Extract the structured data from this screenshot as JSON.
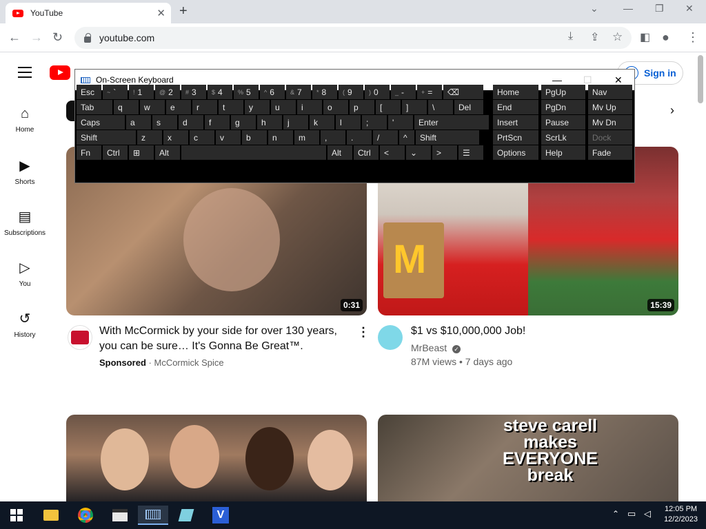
{
  "browser": {
    "tab_title": "YouTube",
    "url": "youtube.com"
  },
  "youtube": {
    "sign_in_label": "Sign in",
    "sidebar": [
      {
        "label": "Home",
        "icon": "home-icon"
      },
      {
        "label": "Shorts",
        "icon": "shorts-icon"
      },
      {
        "label": "Subscriptions",
        "icon": "subscriptions-icon"
      },
      {
        "label": "You",
        "icon": "you-icon"
      },
      {
        "label": "History",
        "icon": "history-icon"
      }
    ],
    "videos": [
      {
        "title_line1": "With McCormick by your side for over 130 years,",
        "title_line2": "you can be sure… It's Gonna Be Great™.",
        "sponsored": "Sponsored",
        "channel": "McCormick Spice",
        "duration": "0:31"
      },
      {
        "title": "$1 vs $10,000,000 Job!",
        "channel": "MrBeast",
        "stats": "87M views • 7 days ago",
        "duration": "15:39"
      }
    ],
    "thumb3_text": [
      "steve carell",
      "makes",
      "EVERYONE",
      "break"
    ]
  },
  "osk": {
    "title": "On-Screen Keyboard",
    "row1": [
      {
        "main": "Esc",
        "sub": ""
      },
      {
        "main": "`",
        "sub": "~"
      },
      {
        "main": "1",
        "sub": "!"
      },
      {
        "main": "2",
        "sub": "@"
      },
      {
        "main": "3",
        "sub": "#"
      },
      {
        "main": "4",
        "sub": "$"
      },
      {
        "main": "5",
        "sub": "%"
      },
      {
        "main": "6",
        "sub": "^"
      },
      {
        "main": "7",
        "sub": "&"
      },
      {
        "main": "8",
        "sub": "*"
      },
      {
        "main": "9",
        "sub": "("
      },
      {
        "main": "0",
        "sub": ")"
      },
      {
        "main": "-",
        "sub": "_"
      },
      {
        "main": "=",
        "sub": "+"
      },
      {
        "main": "⌫",
        "sub": ""
      }
    ],
    "row2": [
      "Tab",
      "q",
      "w",
      "e",
      "r",
      "t",
      "y",
      "u",
      "i",
      "o",
      "p",
      "[",
      "]",
      "\\",
      "Del"
    ],
    "row3": [
      "Caps",
      "a",
      "s",
      "d",
      "f",
      "g",
      "h",
      "j",
      "k",
      "l",
      ";",
      "'",
      "Enter"
    ],
    "row4": [
      "Shift",
      "z",
      "x",
      "c",
      "v",
      "b",
      "n",
      "m",
      ",",
      ".",
      "/",
      "^",
      "Shift"
    ],
    "row5": [
      "Fn",
      "Ctrl",
      "⊞",
      "Alt",
      "",
      "Alt",
      "Ctrl",
      "<",
      "⌄",
      ">",
      "☰"
    ],
    "nav": [
      [
        "Home",
        "PgUp",
        "Nav"
      ],
      [
        "End",
        "PgDn",
        "Mv Up"
      ],
      [
        "Insert",
        "Pause",
        "Mv Dn"
      ],
      [
        "PrtScn",
        "ScrLk",
        "Dock"
      ],
      [
        "Options",
        "Help",
        "Fade"
      ]
    ]
  },
  "taskbar": {
    "time": "12:05 PM",
    "date": "12/2/2023"
  }
}
